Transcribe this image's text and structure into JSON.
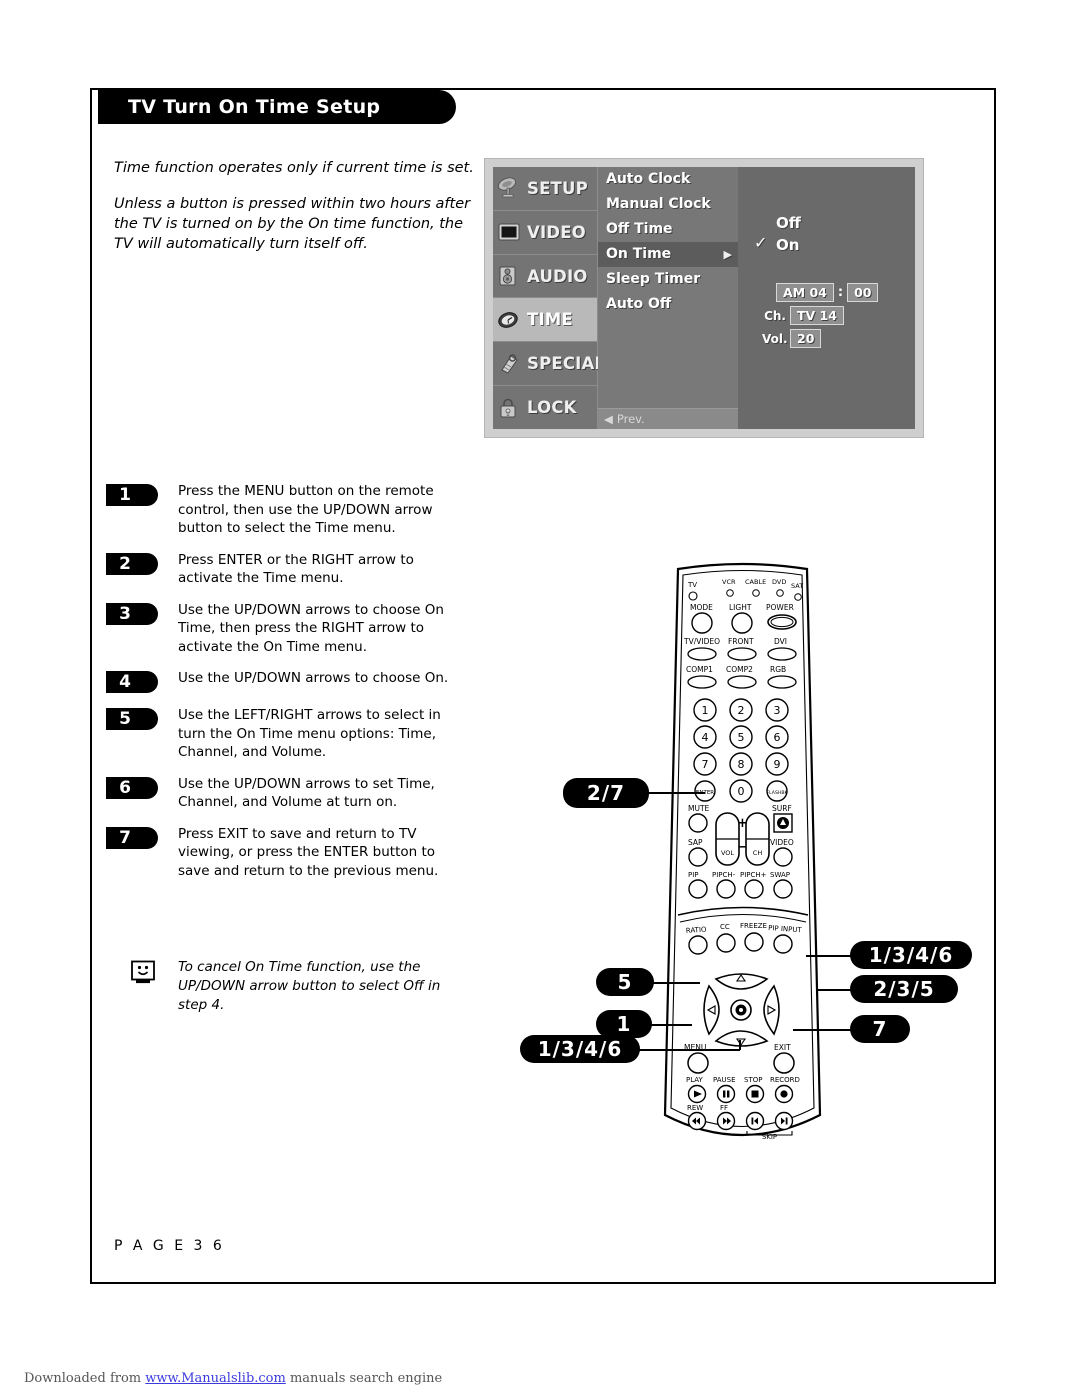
{
  "page": {
    "title": "TV Turn On Time Setup",
    "page_label": "P A G E   3 6"
  },
  "intro": {
    "line1": "Time function operates only if current time is set.",
    "line2": "Unless a button is pressed within two hours after the TV is turned on by the On time function, the TV will automatically turn itself off."
  },
  "osd": {
    "sidebar": [
      {
        "label": "SETUP",
        "icon": "satellite-dish-icon",
        "active": false
      },
      {
        "label": "VIDEO",
        "icon": "screen-icon",
        "active": false
      },
      {
        "label": "AUDIO",
        "icon": "speaker-icon",
        "active": false
      },
      {
        "label": "TIME",
        "icon": "clock-icon",
        "active": true
      },
      {
        "label": "SPECIAL",
        "icon": "tag-icon",
        "active": false
      },
      {
        "label": "LOCK",
        "icon": "padlock-icon",
        "active": false
      }
    ],
    "menu_items": [
      {
        "label": "Auto Clock",
        "selected": false
      },
      {
        "label": "Manual Clock",
        "selected": false
      },
      {
        "label": "Off Time",
        "selected": false
      },
      {
        "label": "On Time",
        "selected": true
      },
      {
        "label": "Sleep Timer",
        "selected": false
      },
      {
        "label": "Auto Off",
        "selected": false
      }
    ],
    "prev_label": "Prev.",
    "prev_arrow": "◀",
    "submenu_arrow": "▶",
    "options": {
      "off_label": "Off",
      "on_label": "On",
      "checkmark": "✓",
      "checked": "On"
    },
    "values": {
      "time_ampm": "AM 04",
      "time_colon": ":",
      "time_minutes": "00",
      "channel_label": "Ch.",
      "channel_value": "TV  14",
      "volume_label": "Vol.",
      "volume_value": "20"
    }
  },
  "steps": [
    {
      "num": "1",
      "text": "Press the MENU button on the remote control, then use the UP/DOWN arrow button to select the Time menu."
    },
    {
      "num": "2",
      "text": "Press ENTER or the RIGHT arrow to activate the Time menu."
    },
    {
      "num": "3",
      "text": "Use the UP/DOWN arrows to choose On Time, then press the RIGHT arrow to activate the On Time menu."
    },
    {
      "num": "4",
      "text": "Use the UP/DOWN arrows to choose On."
    },
    {
      "num": "5",
      "text": "Use the LEFT/RIGHT arrows to select in turn the On Time menu options: Time, Channel, and Volume."
    },
    {
      "num": "6",
      "text": "Use the UP/DOWN arrows to set Time, Channel, and Volume at turn on."
    },
    {
      "num": "7",
      "text": "Press EXIT to save and return to TV viewing, or press the ENTER button to save and return to the previous menu."
    }
  ],
  "note": {
    "icon": "smiley-tv-icon",
    "text": "To cancel On Time function, use the UP/DOWN arrow button to select Off in step 4."
  },
  "callouts": {
    "enter": "2/7",
    "up_arrow": "1/3/4/6",
    "right_arrow": "2/3/5",
    "exit": "7",
    "left_arrow": "5",
    "menu": "1",
    "down_arrow": "1/3/4/6"
  },
  "remote": {
    "device_indicators": [
      "TV",
      "VCR",
      "CABLE",
      "DVD",
      "SAT"
    ],
    "row_mode": [
      "MODE",
      "LIGHT",
      "POWER"
    ],
    "row_input1": [
      "TV/VIDEO",
      "FRONT",
      "DVI"
    ],
    "row_input2": [
      "COMP1",
      "COMP2",
      "RGB"
    ],
    "keypad": [
      "1",
      "2",
      "3",
      "4",
      "5",
      "6",
      "7",
      "8",
      "9"
    ],
    "keypad_bottom": [
      "ENTER",
      "0",
      "FLASHBK"
    ],
    "row_mute": [
      "MUTE",
      "SURF"
    ],
    "row_sap": [
      "SAP",
      "VIDEO"
    ],
    "rockers": [
      "VOL",
      "CH"
    ],
    "rocker_plus": "+",
    "rocker_minus": "−",
    "row_pip": [
      "PIP",
      "PIPCH-",
      "PIPCH+",
      "SWAP"
    ],
    "row_ratio": [
      "RATIO",
      "CC",
      "FREEZE",
      "PIP INPUT"
    ],
    "nav": [
      "MENU",
      "EXIT"
    ],
    "transport1": [
      "PLAY",
      "PAUSE",
      "STOP",
      "RECORD"
    ],
    "transport2": [
      "REW",
      "FF"
    ],
    "skip_label": "SKIP"
  },
  "footer": {
    "prefix": "Downloaded from ",
    "link": "www.Manualslib.com",
    "suffix": " manuals search engine"
  }
}
